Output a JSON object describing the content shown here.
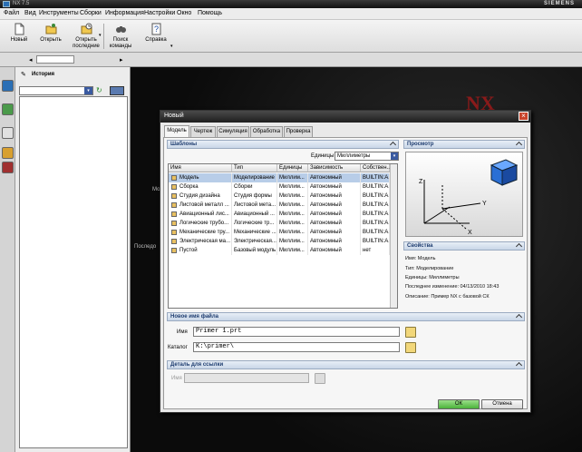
{
  "window": {
    "title": "NX 7.5",
    "brand": "SIEMENS"
  },
  "menu": [
    "Файл",
    "Вид",
    "Инструменты",
    "Сборки",
    "Информация",
    "Настройки",
    "Окно",
    "Помощь"
  ],
  "toolbar": {
    "new": "Новый",
    "open": "Открыть",
    "open_recent_1": "Открыть",
    "open_recent_2": "последние",
    "find_1": "Поиск",
    "find_2": "команды",
    "help": "Справка"
  },
  "history": {
    "title": "История"
  },
  "graphics": {
    "logo": "NX",
    "text1": "Мо",
    "text2": "Последо"
  },
  "dialog": {
    "title": "Новый",
    "close": "×",
    "tabs": [
      "Модель",
      "Чертеж",
      "Симуляция",
      "Обработка",
      "Проверка"
    ],
    "templates_label": "Шаблоны",
    "units_label": "Единицы",
    "units_value": "Миллиметры",
    "columns": [
      "Имя",
      "Тип",
      "Единицы",
      "Зависимость",
      "Собствен..."
    ],
    "rows": [
      [
        "Модель",
        "Моделирование",
        "Миллим...",
        "Автономный",
        "BUILTIN:A..."
      ],
      [
        "Сборка",
        "Сборки",
        "Миллим...",
        "Автономный",
        "BUILTIN:A..."
      ],
      [
        "Студия дизайна",
        "Студия формы",
        "Миллим...",
        "Автономный",
        "BUILTIN:A..."
      ],
      [
        "Листовой металл ...",
        "Листовой мета...",
        "Миллим...",
        "Автономный",
        "BUILTIN:A..."
      ],
      [
        "Авиационный лис...",
        "Авиационный ...",
        "Миллим...",
        "Автономный",
        "BUILTIN:A..."
      ],
      [
        "Логические трубо...",
        "Логические тр...",
        "Миллим...",
        "Автономный",
        "BUILTIN:A..."
      ],
      [
        "Механические тру...",
        "Механические ...",
        "Миллим...",
        "Автономный",
        "BUILTIN:A..."
      ],
      [
        "Электрическая ма...",
        "Электрическая...",
        "Миллим...",
        "Автономный",
        "BUILTIN:A..."
      ],
      [
        "Пустой",
        "Базовый модуль",
        "Миллим...",
        "Автономный",
        "нет"
      ]
    ],
    "preview_label": "Просмотр",
    "axes": {
      "x": "X",
      "y": "Y",
      "z": "Z"
    },
    "properties_label": "Свойства",
    "properties": [
      "Имя: Модель",
      "Тип: Моделирование",
      "Единицы: Миллиметры",
      "Последнее изменение: 04/13/2010 18:43",
      "Описание: Пример NX с базовой СК"
    ],
    "new_file_label": "Новое имя файла",
    "name_label": "Имя",
    "name_value": "Primer 1.prt",
    "folder_label": "Каталог",
    "folder_value": "K:\\primer\\",
    "ref_part_label": "Деталь для ссылки",
    "ref_name_label": "Имя",
    "ok": "ОК",
    "cancel": "Отмена"
  }
}
